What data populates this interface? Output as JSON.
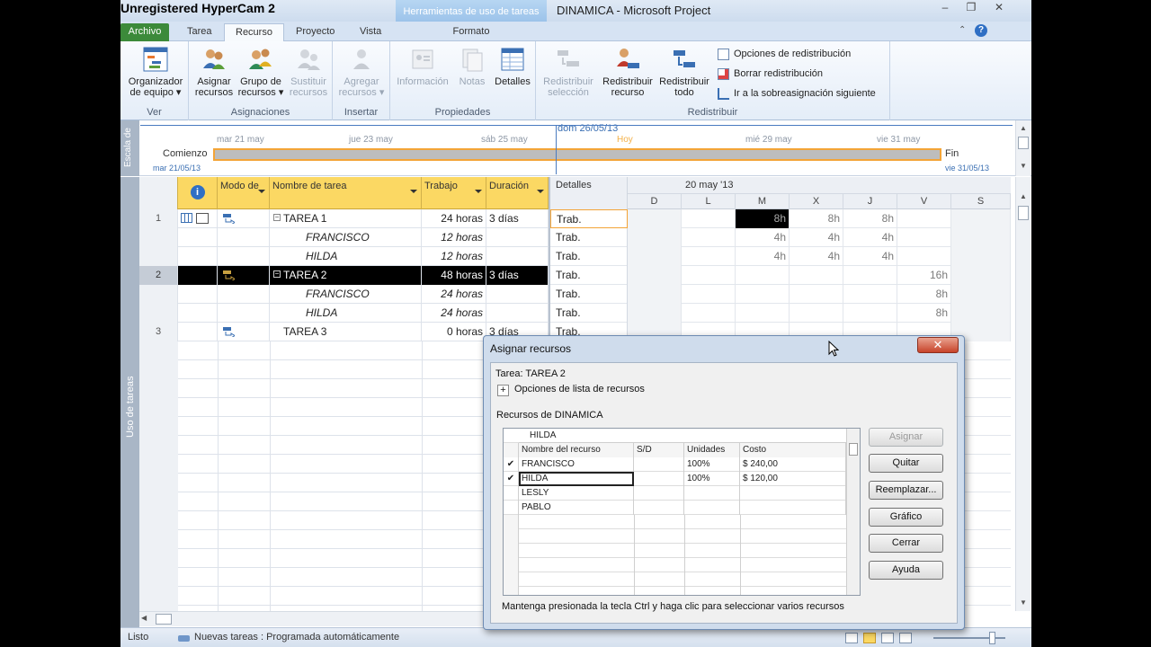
{
  "watermark": "Unregistered HyperCam 2",
  "window": {
    "title": "DINAMICA - Microsoft Project",
    "context_tab_group": "Herramientas de uso de tareas",
    "minimize": "–",
    "restore": "❐",
    "close": "✕"
  },
  "ribbon_tabs": [
    "Archivo",
    "Tarea",
    "Recurso",
    "Proyecto",
    "Vista",
    "Formato"
  ],
  "ribbon": {
    "groups": {
      "ver": "Ver",
      "asignaciones": "Asignaciones",
      "insertar": "Insertar",
      "propiedades": "Propiedades",
      "redistribuir": "Redistribuir"
    },
    "buttons": {
      "organizador_l1": "Organizador",
      "organizador_l2": "de equipo ▾",
      "asignar_l1": "Asignar",
      "asignar_l2": "recursos",
      "grupo_l1": "Grupo de",
      "grupo_l2": "recursos ▾",
      "sustituir_l1": "Sustituir",
      "sustituir_l2": "recursos",
      "agregar_l1": "Agregar",
      "agregar_l2": "recursos ▾",
      "informacion": "Información",
      "notas": "Notas",
      "detalles": "Detalles",
      "redis_sel_l1": "Redistribuir",
      "redis_sel_l2": "selección",
      "redis_rec_l1": "Redistribuir",
      "redis_rec_l2": "recurso",
      "redis_todo_l1": "Redistribuir",
      "redis_todo_l2": "todo",
      "opciones_redis": "Opciones de redistribución",
      "borrar_redis": "Borrar redistribución",
      "ir_sobre": "Ir a la sobreasignación siguiente"
    }
  },
  "timeline": {
    "side_label": "Escala de",
    "today_date": "dom 26/05/13",
    "dates": [
      "mar 21 may",
      "jue 23 may",
      "sáb 25 may",
      "Hoy",
      "mié 29 may",
      "vie 31 may"
    ],
    "start_label": "Comienzo",
    "start_date": "mar 21/05/13",
    "end_label": "Fin",
    "end_date": "vie 31/05/13"
  },
  "view_side_label": "Uso de tareas",
  "grid": {
    "info_icon": "i",
    "headers": [
      "Modo de",
      "Nombre de tarea",
      "Trabajo",
      "Duración"
    ],
    "rows": [
      {
        "num": "1",
        "name": "TAREA 1",
        "trabajo": "24 horas",
        "duracion": "3 días"
      },
      {
        "num": "",
        "name": "FRANCISCO",
        "trabajo": "12 horas",
        "duracion": ""
      },
      {
        "num": "",
        "name": "HILDA",
        "trabajo": "12 horas",
        "duracion": ""
      },
      {
        "num": "2",
        "name": "TAREA 2",
        "trabajo": "48 horas",
        "duracion": "3 días"
      },
      {
        "num": "",
        "name": "FRANCISCO",
        "trabajo": "24 horas",
        "duracion": ""
      },
      {
        "num": "",
        "name": "HILDA",
        "trabajo": "24 horas",
        "duracion": ""
      },
      {
        "num": "3",
        "name": "TAREA 3",
        "trabajo": "0 horas",
        "duracion": "3 días"
      }
    ]
  },
  "detail": {
    "header": "Detalles",
    "week_label": "20 may '13",
    "days": [
      "D",
      "L",
      "M",
      "X",
      "J",
      "V",
      "S"
    ],
    "label": "Trab.",
    "rows": [
      [
        "",
        "",
        "8h",
        "8h",
        "8h",
        "",
        ""
      ],
      [
        "",
        "",
        "4h",
        "4h",
        "4h",
        "",
        ""
      ],
      [
        "",
        "",
        "4h",
        "4h",
        "4h",
        "",
        ""
      ],
      [
        "",
        "",
        "",
        "",
        "",
        "16h",
        ""
      ],
      [
        "",
        "",
        "",
        "",
        "",
        "8h",
        ""
      ],
      [
        "",
        "",
        "",
        "",
        "",
        "8h",
        ""
      ],
      [
        "",
        "",
        "",
        "",
        "",
        "",
        ""
      ]
    ]
  },
  "statusbar": {
    "ready": "Listo",
    "new_tasks": "Nuevas tareas : Programada automáticamente"
  },
  "dialog": {
    "title": "Asignar recursos",
    "task_label": "Tarea: TAREA 2",
    "options_label": "Opciones de lista de recursos",
    "resources_label": "Recursos de DINAMICA",
    "edit_value": "HILDA",
    "columns": [
      "Nombre del recurso",
      "S/D",
      "Unidades",
      "Costo"
    ],
    "rows": [
      {
        "check": "✔",
        "name": "FRANCISCO",
        "sd": "",
        "units": "100%",
        "cost": "$ 240,00"
      },
      {
        "check": "✔",
        "name": "HILDA",
        "sd": "",
        "units": "100%",
        "cost": "$ 120,00"
      },
      {
        "check": "",
        "name": "LESLY",
        "sd": "",
        "units": "",
        "cost": ""
      },
      {
        "check": "",
        "name": "PABLO",
        "sd": "",
        "units": "",
        "cost": ""
      }
    ],
    "buttons": {
      "asignar": "Asignar",
      "quitar": "Quitar",
      "reemplazar": "Reemplazar...",
      "grafico": "Gráfico",
      "cerrar": "Cerrar",
      "ayuda": "Ayuda"
    },
    "hint": "Mantenga presionada la tecla Ctrl y haga clic para seleccionar varios recursos",
    "close_glyph": "✕"
  }
}
